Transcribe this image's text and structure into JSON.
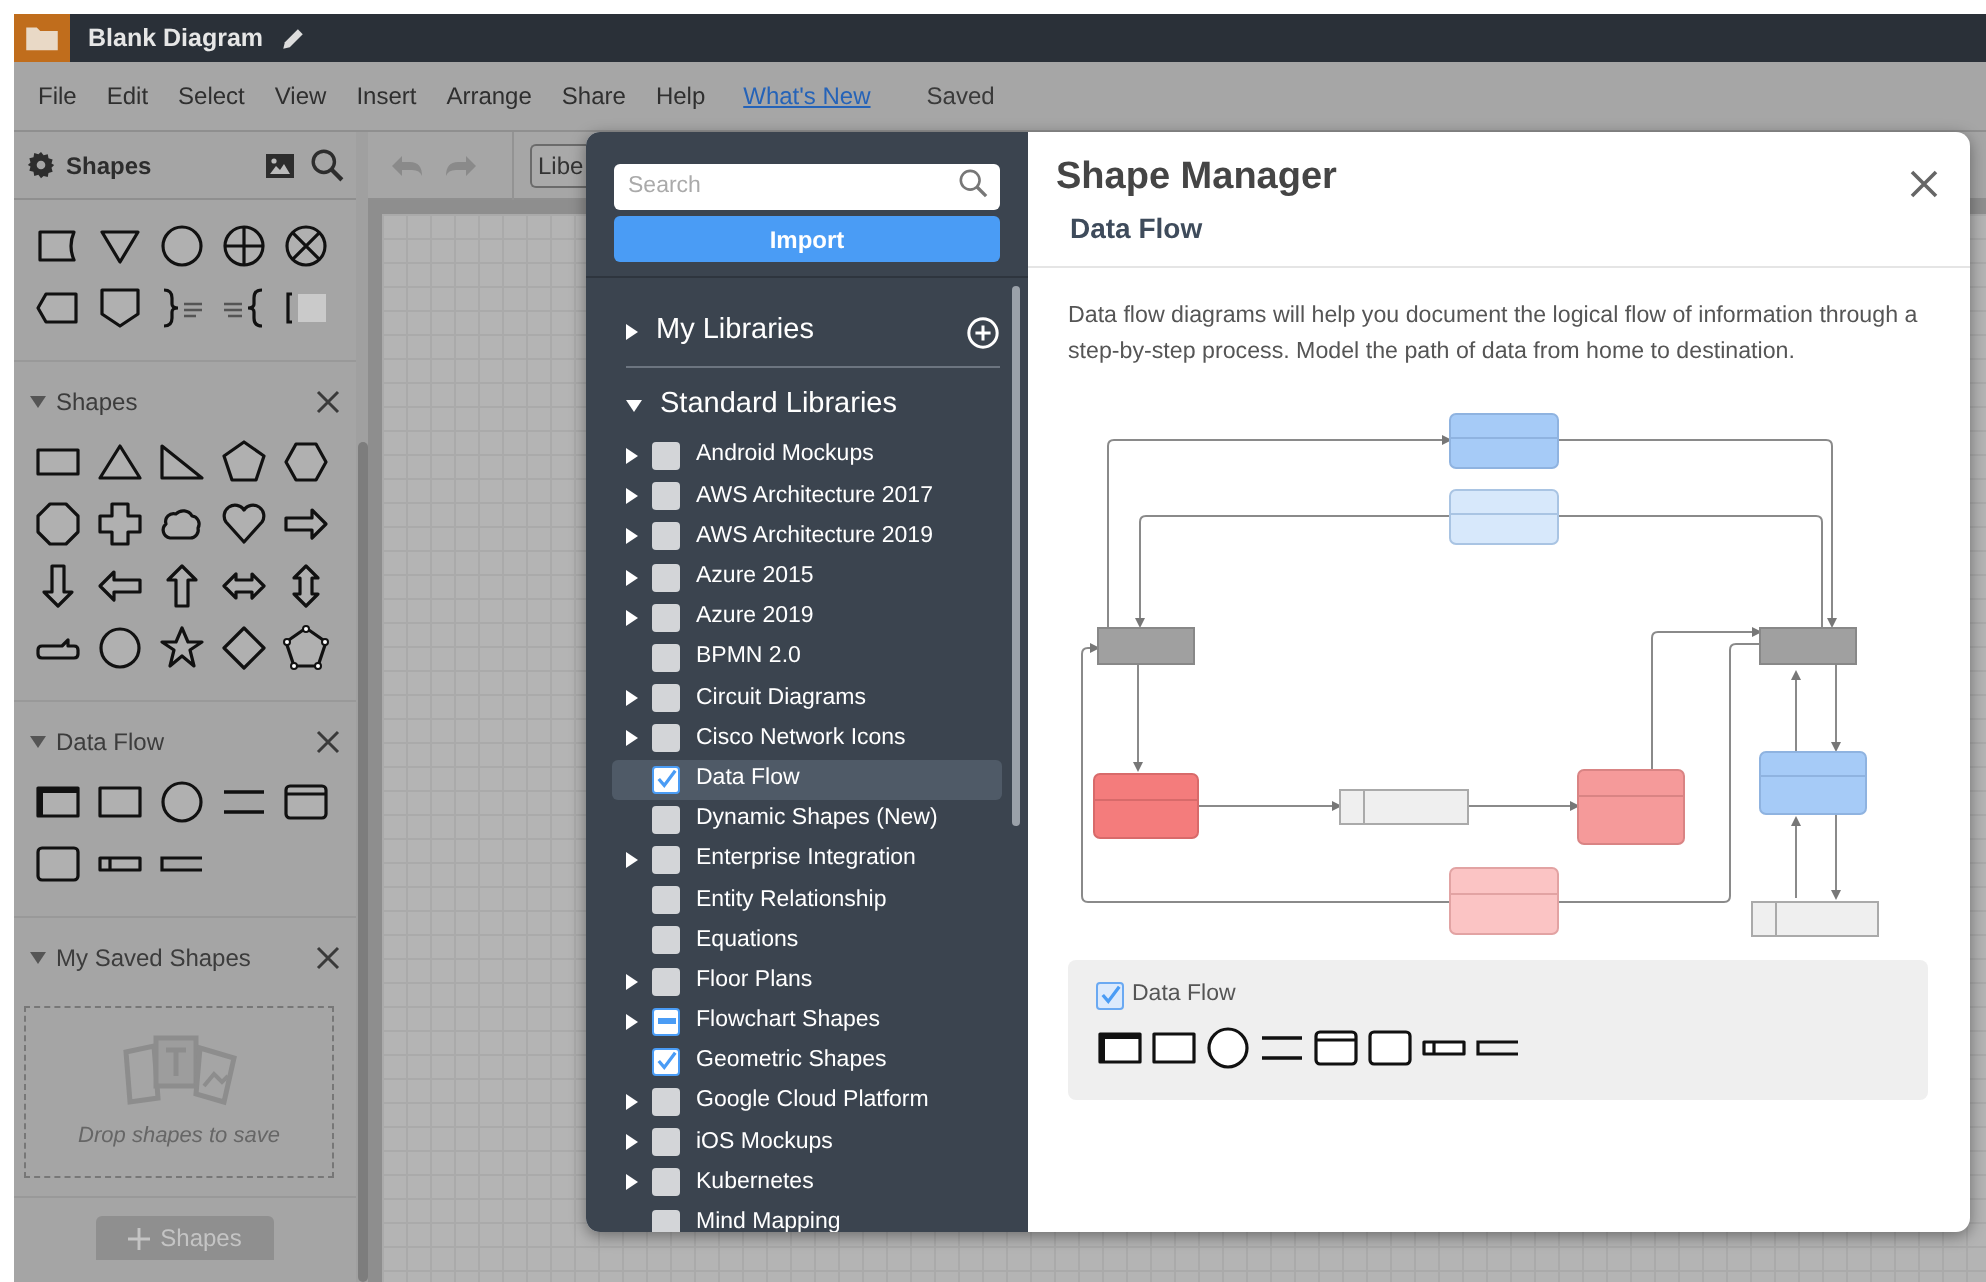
{
  "app_bar": {
    "title": "Blank Diagram"
  },
  "menu": [
    {
      "label": "File",
      "kind": "menu"
    },
    {
      "label": "Edit",
      "kind": "menu"
    },
    {
      "label": "Select",
      "kind": "menu"
    },
    {
      "label": "View",
      "kind": "menu"
    },
    {
      "label": "Insert",
      "kind": "menu"
    },
    {
      "label": "Arrange",
      "kind": "menu"
    },
    {
      "label": "Share",
      "kind": "menu"
    },
    {
      "label": "Help",
      "kind": "menu"
    },
    {
      "label": "What's New",
      "kind": "link"
    },
    {
      "label": "Saved",
      "kind": "status"
    }
  ],
  "shapes_panel": {
    "title": "Shapes",
    "sections": [
      {
        "title": "Shapes",
        "expanded": true
      },
      {
        "title": "Data Flow",
        "expanded": true
      },
      {
        "title": "My Saved Shapes",
        "expanded": true
      }
    ],
    "drop_hint": "Drop shapes to save",
    "add_button": "Shapes"
  },
  "toolbar": {
    "font_field": "Libe"
  },
  "shape_manager": {
    "search": {
      "placeholder": "Search"
    },
    "import_button": "Import",
    "my_libraries": {
      "label": "My Libraries",
      "expanded": false
    },
    "standard_libraries": {
      "label": "Standard Libraries",
      "expanded": true,
      "items": [
        {
          "label": "Android Mockups",
          "has_children": true,
          "checked": false,
          "indeterminate": false,
          "selected": false
        },
        {
          "label": "AWS Architecture 2017",
          "has_children": true,
          "checked": false,
          "indeterminate": false,
          "selected": false
        },
        {
          "label": "AWS Architecture 2019",
          "has_children": true,
          "checked": false,
          "indeterminate": false,
          "selected": false
        },
        {
          "label": "Azure 2015",
          "has_children": true,
          "checked": false,
          "indeterminate": false,
          "selected": false
        },
        {
          "label": "Azure 2019",
          "has_children": true,
          "checked": false,
          "indeterminate": false,
          "selected": false
        },
        {
          "label": "BPMN 2.0",
          "has_children": false,
          "checked": false,
          "indeterminate": false,
          "selected": false
        },
        {
          "label": "Circuit Diagrams",
          "has_children": true,
          "checked": false,
          "indeterminate": false,
          "selected": false
        },
        {
          "label": "Cisco Network Icons",
          "has_children": true,
          "checked": false,
          "indeterminate": false,
          "selected": false
        },
        {
          "label": "Data Flow",
          "has_children": false,
          "checked": true,
          "indeterminate": false,
          "selected": true
        },
        {
          "label": "Dynamic Shapes (New)",
          "has_children": false,
          "checked": false,
          "indeterminate": false,
          "selected": false
        },
        {
          "label": "Enterprise Integration",
          "has_children": true,
          "checked": false,
          "indeterminate": false,
          "selected": false
        },
        {
          "label": "Entity Relationship",
          "has_children": false,
          "checked": false,
          "indeterminate": false,
          "selected": false
        },
        {
          "label": "Equations",
          "has_children": false,
          "checked": false,
          "indeterminate": false,
          "selected": false
        },
        {
          "label": "Floor Plans",
          "has_children": true,
          "checked": false,
          "indeterminate": false,
          "selected": false
        },
        {
          "label": "Flowchart Shapes",
          "has_children": true,
          "checked": false,
          "indeterminate": true,
          "selected": false
        },
        {
          "label": "Geometric Shapes",
          "has_children": false,
          "checked": true,
          "indeterminate": false,
          "selected": false
        },
        {
          "label": "Google Cloud Platform",
          "has_children": true,
          "checked": false,
          "indeterminate": false,
          "selected": false
        },
        {
          "label": "iOS Mockups",
          "has_children": true,
          "checked": false,
          "indeterminate": false,
          "selected": false
        },
        {
          "label": "Kubernetes",
          "has_children": true,
          "checked": false,
          "indeterminate": false,
          "selected": false
        },
        {
          "label": "Mind Mapping",
          "has_children": false,
          "checked": false,
          "indeterminate": false,
          "selected": false
        }
      ]
    },
    "title": "Shape Manager",
    "subtitle": "Data Flow",
    "description": "Data flow diagrams will help you document the logical flow of information through a step-by-step process. Model the path of data from home to destination.",
    "preview": {
      "label": "Data Flow",
      "checked": true
    }
  }
}
